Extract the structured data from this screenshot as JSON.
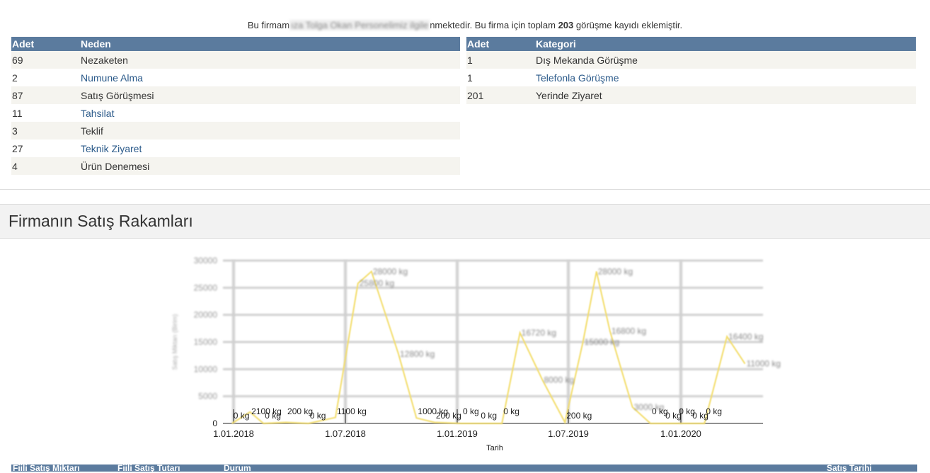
{
  "intro": {
    "prefix": "Bu firmam",
    "redacted": "ıza Tolga Okan Personelimiz ilgile",
    "middle": "nmektedir. Bu firma için toplam ",
    "count": "203",
    "suffix": "  görüşme kayıdı eklemiştir."
  },
  "reasons_table": {
    "headers": [
      "Adet",
      "Neden"
    ],
    "rows": [
      {
        "count": "69",
        "label": "Nezaketen"
      },
      {
        "count": "2",
        "label": "Numune Alma"
      },
      {
        "count": "87",
        "label": "Satış Görüşmesi"
      },
      {
        "count": "11",
        "label": "Tahsilat"
      },
      {
        "count": "3",
        "label": "Teklif"
      },
      {
        "count": "27",
        "label": "Teknik Ziyaret"
      },
      {
        "count": "4",
        "label": "Ürün Denemesi"
      }
    ]
  },
  "category_table": {
    "headers": [
      "Adet",
      "Kategori"
    ],
    "rows": [
      {
        "count": "1",
        "label": "Dış Mekanda Görüşme"
      },
      {
        "count": "1",
        "label": "Telefonla Görüşme"
      },
      {
        "count": "201",
        "label": "Yerinde Ziyaret"
      }
    ]
  },
  "section": {
    "title": "Firmanın Satış Rakamları"
  },
  "chart_data": {
    "type": "line",
    "xlabel": "Tarih",
    "ylabel": "Satış Miktarı (Birim)",
    "ylim": [
      0,
      30000
    ],
    "yticks": [
      "0",
      "5000",
      "10000",
      "15000",
      "20000",
      "25000",
      "30000"
    ],
    "xticks": [
      "1.01.2018",
      "1.07.2018",
      "1.01.2019",
      "1.07.2019",
      "1.01.2020"
    ],
    "grid": true,
    "series_color": "#f3dd6b",
    "points": [
      {
        "x": 0.02,
        "y": 0,
        "label": "0 kg"
      },
      {
        "x": 0.06,
        "y": 2100,
        "label": "2100 kg"
      },
      {
        "x": 0.09,
        "y": 0,
        "label": "0 kg"
      },
      {
        "x": 0.14,
        "y": 200,
        "label": "200 kg"
      },
      {
        "x": 0.19,
        "y": 0,
        "label": "0 kg"
      },
      {
        "x": 0.25,
        "y": 1100,
        "label": "1100 kg"
      },
      {
        "x": 0.3,
        "y": 25800,
        "label": "25800 kg"
      },
      {
        "x": 0.33,
        "y": 28000,
        "label": "28000 kg"
      },
      {
        "x": 0.39,
        "y": 12800,
        "label": "12800 kg"
      },
      {
        "x": 0.43,
        "y": 1000,
        "label": "1000 kg"
      },
      {
        "x": 0.47,
        "y": 200,
        "label": "200 kg"
      },
      {
        "x": 0.53,
        "y": 0,
        "label": "0 kg"
      },
      {
        "x": 0.57,
        "y": 0,
        "label": "0 kg"
      },
      {
        "x": 0.62,
        "y": 0,
        "label": "0 kg"
      },
      {
        "x": 0.66,
        "y": 16700,
        "label": "16720 kg"
      },
      {
        "x": 0.71,
        "y": 8000,
        "label": "8000 kg"
      },
      {
        "x": 0.76,
        "y": 200,
        "label": "200 kg"
      },
      {
        "x": 0.8,
        "y": 15000,
        "label": "15000 kg"
      },
      {
        "x": 0.83,
        "y": 28000,
        "label": "28000 kg"
      },
      {
        "x": 0.86,
        "y": 17000,
        "label": "16800 kg"
      },
      {
        "x": 0.91,
        "y": 3000,
        "label": "3000 kg"
      },
      {
        "x": 0.95,
        "y": 0,
        "label": "0 kg"
      },
      {
        "x": 0.98,
        "y": 0,
        "label": "0 kg"
      },
      {
        "x": 1.01,
        "y": 0,
        "label": "0 kg"
      },
      {
        "x": 1.04,
        "y": 0,
        "label": "0 kg"
      },
      {
        "x": 1.07,
        "y": 0,
        "label": "0 kg"
      },
      {
        "x": 1.12,
        "y": 16000,
        "label": "16400 kg"
      },
      {
        "x": 1.16,
        "y": 11000,
        "label": "11000 kg"
      }
    ]
  },
  "bottom_table": {
    "headers": [
      "Fiili Satış Miktarı",
      "Fiili Satış Tutarı",
      "Durum",
      "Satış Tarihi"
    ]
  }
}
